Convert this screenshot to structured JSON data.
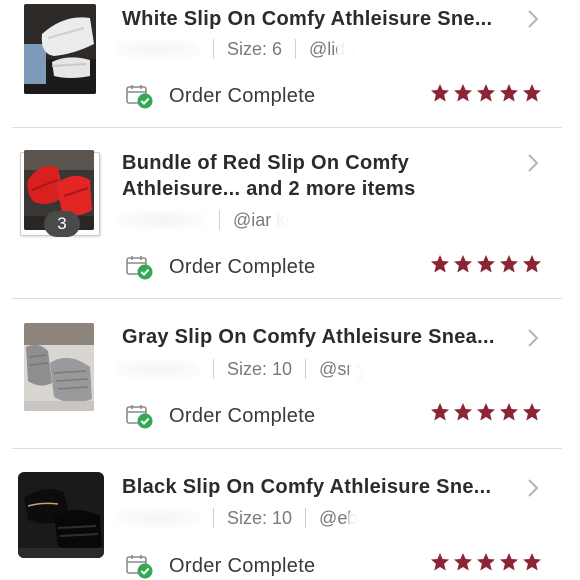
{
  "orders": [
    {
      "title": "White Slip On Comfy Athleisure Sne...",
      "size_label": "Size: 6",
      "seller": "@lid  ni",
      "status": "Order Complete",
      "rating": 5,
      "bundle_count": null
    },
    {
      "title": "Bundle of Red Slip On Comfy Athleisure... and 2 more items",
      "size_label": "",
      "seller": "@iar  ke",
      "status": "Order Complete",
      "rating": 5,
      "bundle_count": "3"
    },
    {
      "title": "Gray Slip On Comfy Athleisure Snea...",
      "size_label": "Size: 10",
      "seller": "@sr  y",
      "status": "Order Complete",
      "rating": 5,
      "bundle_count": null
    },
    {
      "title": "Black Slip On Comfy Athleisure Sne...",
      "size_label": "Size: 10",
      "seller": "@eb  off",
      "status": "Order Complete",
      "rating": 5,
      "bundle_count": null
    }
  ],
  "colors": {
    "star": "#8b2535",
    "check_badge": "#34a853",
    "divider": "#dedede",
    "bundle_badge": "#4a4a4a"
  },
  "icons": {
    "status": "calendar-check-icon",
    "rating": "star-icon",
    "navigate": "chevron-right-icon"
  }
}
